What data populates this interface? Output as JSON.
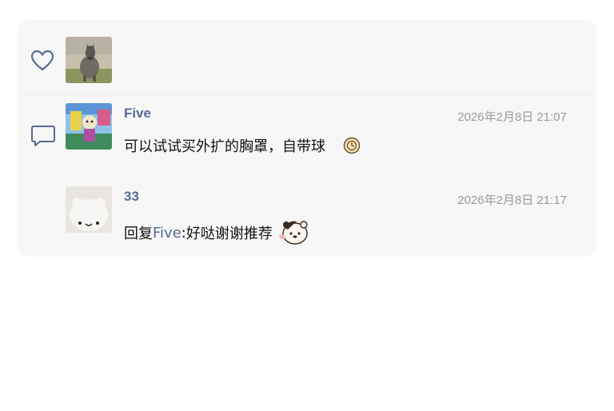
{
  "likes": {
    "heart_icon": "heart-outline-icon",
    "avatars": [
      {
        "alt": "donkey-photo-avatar"
      }
    ]
  },
  "comments_icon": "comment-bubble-icon",
  "comments": [
    {
      "username": "Five",
      "timestamp": "2026年2月8日 21:07",
      "text": "可以试试买外扩的胸罩，自带球",
      "emoji": "clock-emoji"
    },
    {
      "username": "33",
      "timestamp": "2026年2月8日 21:17",
      "reply_prefix": "回复",
      "reply_to": "Five",
      "reply_sep": ":",
      "text": " 好哒谢谢推荐",
      "emoji": "cute-bear-sticker"
    }
  ],
  "colors": {
    "name_blue": "#576b95",
    "panel_bg": "#f7f7f7",
    "timestamp_gray": "#9a9a9a"
  }
}
